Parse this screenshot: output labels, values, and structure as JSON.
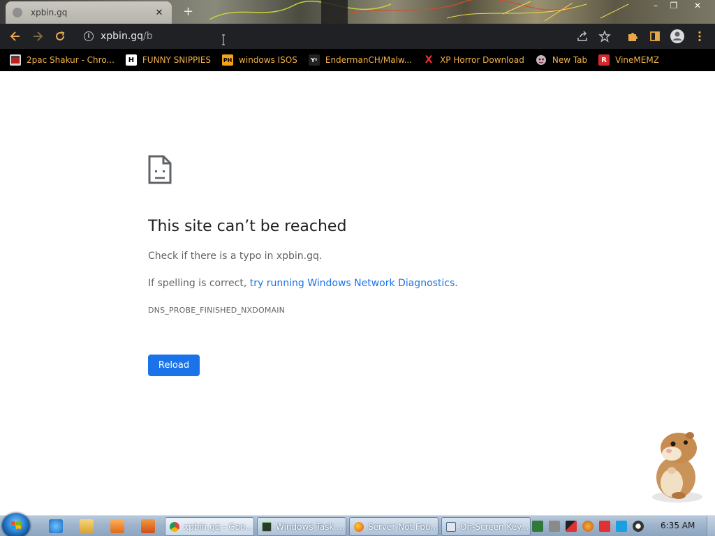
{
  "browser": {
    "tab": {
      "title": "xpbin.gq",
      "close": "✕"
    },
    "new_tab_symbol": "+",
    "window_controls": {
      "minimize": "–",
      "restore": "❐",
      "close": "✕"
    },
    "address": {
      "host": "xpbin.gq",
      "path": "/b"
    }
  },
  "bookmarks": [
    {
      "label": "2pac Shakur - Chro...",
      "icon": "film-strip-icon"
    },
    {
      "label": "FUNNY SNIPPIES",
      "icon": "letter-h-icon",
      "glyph": "H"
    },
    {
      "label": "windows ISOS",
      "icon": "ph-logo-icon",
      "glyph": "PH"
    },
    {
      "label": "EndermanCH/Malw...",
      "icon": "youtube-letter-icon",
      "glyph": "Y²"
    },
    {
      "label": "XP Horror Download",
      "icon": "red-x-icon",
      "glyph": "X"
    },
    {
      "label": "New Tab",
      "icon": "globe-face-icon"
    },
    {
      "label": "VineMEMZ",
      "icon": "red-r-icon",
      "glyph": "R"
    }
  ],
  "error_page": {
    "title": "This site can’t be reached",
    "typo_text": "Check if there is a typo in xpbin.gq.",
    "spell_prefix": "If spelling is correct, ",
    "spell_link": "try running Windows Network Diagnostics",
    "spell_suffix": ".",
    "code": "DNS_PROBE_FINISHED_NXDOMAIN",
    "reload_label": "Reload"
  },
  "taskbar": {
    "tasks": [
      {
        "label": "xpbin.gq - Goo...",
        "icon": "chrome-icon",
        "active": true
      },
      {
        "label": "Windows Task ...",
        "icon": "task-manager-icon",
        "active": false
      },
      {
        "label": "Server Not Fou...",
        "icon": "firefox-icon",
        "active": false
      },
      {
        "label": "On-Screen Key...",
        "icon": "keyboard-icon",
        "active": false
      }
    ],
    "clock": "6:35 AM"
  },
  "colors": {
    "bookmark_text": "#f2b24a",
    "link": "#1a73e8",
    "reload_button": "#1a73e8",
    "toolbar": "#202124",
    "bookmarks_bar": "#000000"
  }
}
